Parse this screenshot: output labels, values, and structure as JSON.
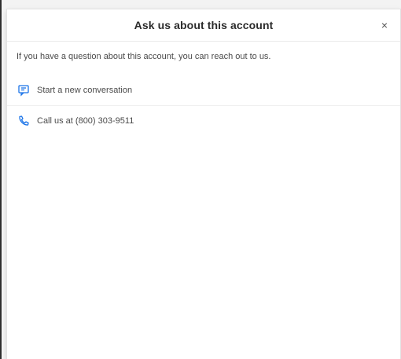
{
  "modal": {
    "title": "Ask us about this account",
    "close_symbol": "×",
    "intro_text": "If you have a question about this account, you can reach out to us.",
    "options": [
      {
        "label": "Start a new conversation",
        "icon": "chat-icon"
      },
      {
        "label": "Call us at (800) 303-9511",
        "icon": "phone-icon"
      }
    ],
    "accent_color": "#1a73e8"
  }
}
